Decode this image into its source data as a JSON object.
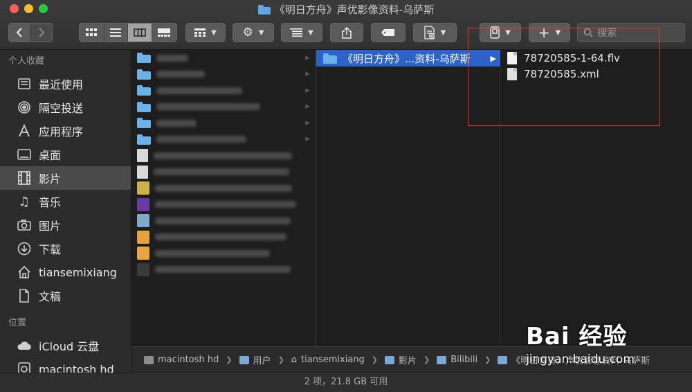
{
  "window": {
    "title": "《明日方舟》声优影像资料-乌萨斯"
  },
  "toolbar": {
    "back_icon": "chevron-left",
    "forward_icon": "chevron-right",
    "search_placeholder": "搜索"
  },
  "sidebar": {
    "favorites_header": "个人收藏",
    "items": [
      {
        "label": "最近使用",
        "icon": "clock-icon"
      },
      {
        "label": "隔空投送",
        "icon": "airdrop-icon"
      },
      {
        "label": "应用程序",
        "icon": "apps-icon"
      },
      {
        "label": "桌面",
        "icon": "desktop-icon"
      },
      {
        "label": "影片",
        "icon": "film-icon"
      },
      {
        "label": "音乐",
        "icon": "music-icon"
      },
      {
        "label": "图片",
        "icon": "camera-icon"
      },
      {
        "label": "下载",
        "icon": "download-icon"
      },
      {
        "label": "tiansemixiang",
        "icon": "home-icon"
      },
      {
        "label": "文稿",
        "icon": "document-icon"
      }
    ],
    "locations_header": "位置",
    "locations": [
      {
        "label": "iCloud 云盘",
        "icon": "cloud-icon"
      },
      {
        "label": "macintosh hd",
        "icon": "disk-icon"
      }
    ]
  },
  "column2": {
    "selected_label": "《明日方舟》...资料-乌萨斯"
  },
  "column3": {
    "files": [
      {
        "name": "78720585-1-64.flv",
        "icon": "flv-file-icon"
      },
      {
        "name": "78720585.xml",
        "icon": "xml-file-icon"
      }
    ]
  },
  "pathbar": {
    "segments": [
      "macintosh hd",
      "用户",
      "tiansemixiang",
      "影片",
      "Bilibili",
      "《明日方舟》声优影像资料-乌萨斯"
    ]
  },
  "status": {
    "text": "2 项，21.8 GB 可用"
  },
  "watermark": {
    "logo": "Bai 经验",
    "url": "jingyan.baidu.com"
  }
}
